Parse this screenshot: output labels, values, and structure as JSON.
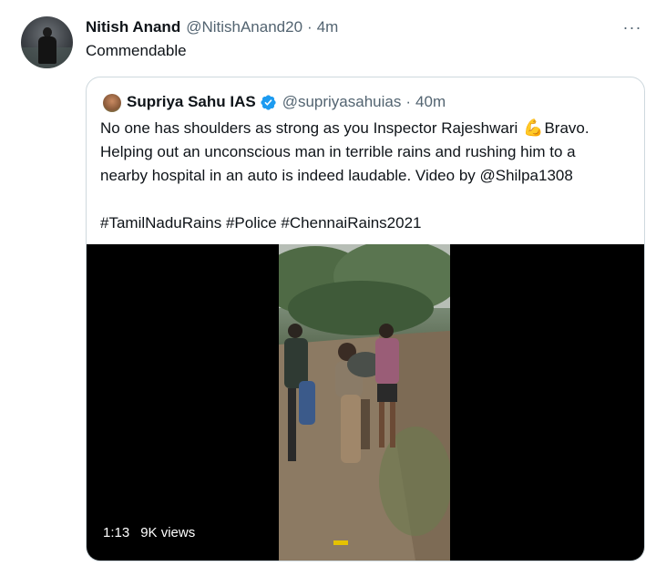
{
  "tweet": {
    "author_name": "Nitish Anand",
    "author_handle": "@NitishAnand20",
    "separator": "·",
    "time": "4m",
    "more_label": "···",
    "text": "Commendable"
  },
  "quoted_tweet": {
    "author_name": "Supriya Sahu IAS",
    "author_handle": "@supriyasahuias",
    "separator": "·",
    "time": "40m",
    "verified": true,
    "line_1a": "No one has shoulders as strong as you Inspector Rajeshwari",
    "emoji": "💪",
    "line_1b": "Bravo.",
    "line_2": "Helping out an unconscious man in terrible rains and rushing him to a",
    "line_3": "nearby hospital in an auto is indeed laudable. Video by @Shilpa1308",
    "hashtags": "#TamilNaduRains #Police #ChennaiRains2021",
    "media": {
      "type": "video",
      "duration": "1:13",
      "views": "9K views"
    }
  },
  "colors": {
    "text_primary": "#0f1419",
    "text_secondary": "#536471",
    "border": "#cfd9de",
    "verified_blue": "#1d9bf0",
    "video_background": "#000000"
  },
  "icons": [
    "more-icon",
    "verified-badge-icon",
    "flexed-biceps-emoji"
  ]
}
